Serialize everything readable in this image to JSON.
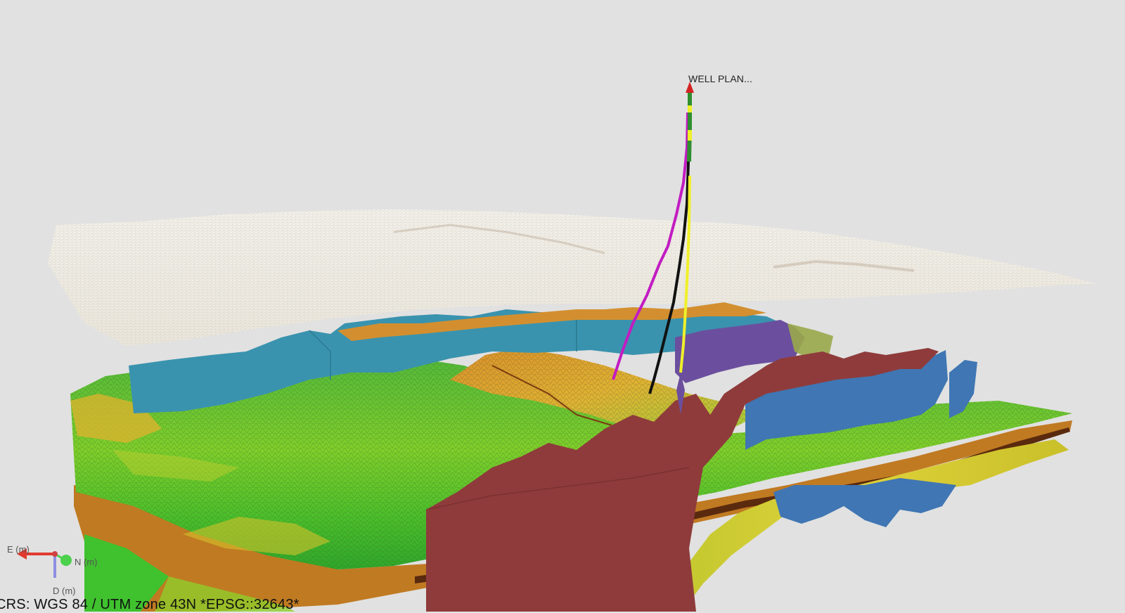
{
  "viewport": {
    "background": "#e1e1e1"
  },
  "scene": {
    "well_label": "WELL PLAN...",
    "crs_label": "CRS: WGS 84 / UTM zone 43N *EPSG::32643*"
  },
  "axes": {
    "e_label": "E (m)",
    "n_label": "N (m)",
    "d_label": "D (m)",
    "e_color": "#e23a2e",
    "n_color": "#4bd14b",
    "d_color": "#8e8fe0"
  },
  "colors": {
    "topo_surface": "#f1efe8",
    "horizon_surface_green": "#6fc437",
    "horizon_surface_orange": "#d9932e",
    "fault_teal": "#3a93ae",
    "fault_red": "#8f3b3b",
    "fault_blue": "#3f76b3",
    "fault_purple": "#6b4f9e",
    "horizon_yellow": "#d4c52c",
    "well_magenta": "#c21cc2",
    "well_black": "#111111",
    "well_yellow": "#f0f02a",
    "well_green": "#2f8f2f"
  }
}
